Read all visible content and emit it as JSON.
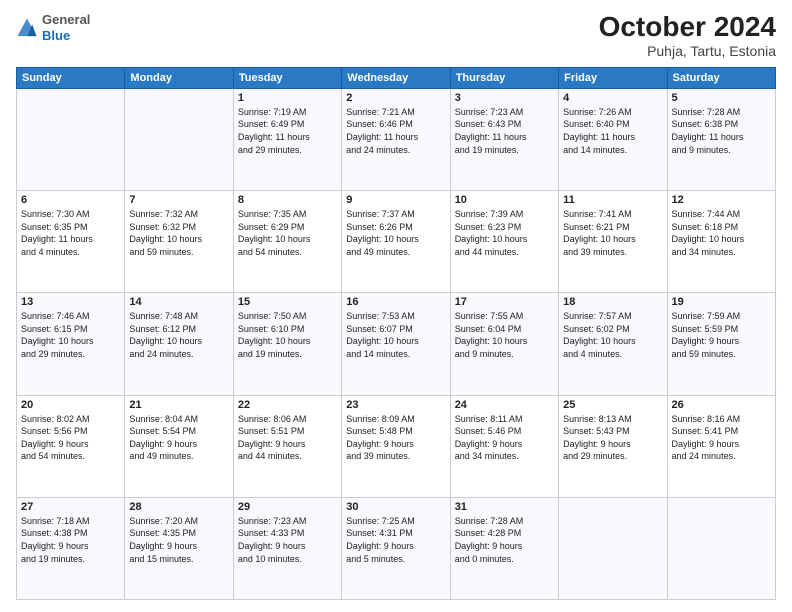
{
  "header": {
    "logo_line1": "General",
    "logo_line2": "Blue",
    "title": "October 2024",
    "subtitle": "Puhja, Tartu, Estonia"
  },
  "weekdays": [
    "Sunday",
    "Monday",
    "Tuesday",
    "Wednesday",
    "Thursday",
    "Friday",
    "Saturday"
  ],
  "weeks": [
    [
      {
        "day": "",
        "text": ""
      },
      {
        "day": "",
        "text": ""
      },
      {
        "day": "1",
        "text": "Sunrise: 7:19 AM\nSunset: 6:49 PM\nDaylight: 11 hours\nand 29 minutes."
      },
      {
        "day": "2",
        "text": "Sunrise: 7:21 AM\nSunset: 6:46 PM\nDaylight: 11 hours\nand 24 minutes."
      },
      {
        "day": "3",
        "text": "Sunrise: 7:23 AM\nSunset: 6:43 PM\nDaylight: 11 hours\nand 19 minutes."
      },
      {
        "day": "4",
        "text": "Sunrise: 7:26 AM\nSunset: 6:40 PM\nDaylight: 11 hours\nand 14 minutes."
      },
      {
        "day": "5",
        "text": "Sunrise: 7:28 AM\nSunset: 6:38 PM\nDaylight: 11 hours\nand 9 minutes."
      }
    ],
    [
      {
        "day": "6",
        "text": "Sunrise: 7:30 AM\nSunset: 6:35 PM\nDaylight: 11 hours\nand 4 minutes."
      },
      {
        "day": "7",
        "text": "Sunrise: 7:32 AM\nSunset: 6:32 PM\nDaylight: 10 hours\nand 59 minutes."
      },
      {
        "day": "8",
        "text": "Sunrise: 7:35 AM\nSunset: 6:29 PM\nDaylight: 10 hours\nand 54 minutes."
      },
      {
        "day": "9",
        "text": "Sunrise: 7:37 AM\nSunset: 6:26 PM\nDaylight: 10 hours\nand 49 minutes."
      },
      {
        "day": "10",
        "text": "Sunrise: 7:39 AM\nSunset: 6:23 PM\nDaylight: 10 hours\nand 44 minutes."
      },
      {
        "day": "11",
        "text": "Sunrise: 7:41 AM\nSunset: 6:21 PM\nDaylight: 10 hours\nand 39 minutes."
      },
      {
        "day": "12",
        "text": "Sunrise: 7:44 AM\nSunset: 6:18 PM\nDaylight: 10 hours\nand 34 minutes."
      }
    ],
    [
      {
        "day": "13",
        "text": "Sunrise: 7:46 AM\nSunset: 6:15 PM\nDaylight: 10 hours\nand 29 minutes."
      },
      {
        "day": "14",
        "text": "Sunrise: 7:48 AM\nSunset: 6:12 PM\nDaylight: 10 hours\nand 24 minutes."
      },
      {
        "day": "15",
        "text": "Sunrise: 7:50 AM\nSunset: 6:10 PM\nDaylight: 10 hours\nand 19 minutes."
      },
      {
        "day": "16",
        "text": "Sunrise: 7:53 AM\nSunset: 6:07 PM\nDaylight: 10 hours\nand 14 minutes."
      },
      {
        "day": "17",
        "text": "Sunrise: 7:55 AM\nSunset: 6:04 PM\nDaylight: 10 hours\nand 9 minutes."
      },
      {
        "day": "18",
        "text": "Sunrise: 7:57 AM\nSunset: 6:02 PM\nDaylight: 10 hours\nand 4 minutes."
      },
      {
        "day": "19",
        "text": "Sunrise: 7:59 AM\nSunset: 5:59 PM\nDaylight: 9 hours\nand 59 minutes."
      }
    ],
    [
      {
        "day": "20",
        "text": "Sunrise: 8:02 AM\nSunset: 5:56 PM\nDaylight: 9 hours\nand 54 minutes."
      },
      {
        "day": "21",
        "text": "Sunrise: 8:04 AM\nSunset: 5:54 PM\nDaylight: 9 hours\nand 49 minutes."
      },
      {
        "day": "22",
        "text": "Sunrise: 8:06 AM\nSunset: 5:51 PM\nDaylight: 9 hours\nand 44 minutes."
      },
      {
        "day": "23",
        "text": "Sunrise: 8:09 AM\nSunset: 5:48 PM\nDaylight: 9 hours\nand 39 minutes."
      },
      {
        "day": "24",
        "text": "Sunrise: 8:11 AM\nSunset: 5:46 PM\nDaylight: 9 hours\nand 34 minutes."
      },
      {
        "day": "25",
        "text": "Sunrise: 8:13 AM\nSunset: 5:43 PM\nDaylight: 9 hours\nand 29 minutes."
      },
      {
        "day": "26",
        "text": "Sunrise: 8:16 AM\nSunset: 5:41 PM\nDaylight: 9 hours\nand 24 minutes."
      }
    ],
    [
      {
        "day": "27",
        "text": "Sunrise: 7:18 AM\nSunset: 4:38 PM\nDaylight: 9 hours\nand 19 minutes."
      },
      {
        "day": "28",
        "text": "Sunrise: 7:20 AM\nSunset: 4:35 PM\nDaylight: 9 hours\nand 15 minutes."
      },
      {
        "day": "29",
        "text": "Sunrise: 7:23 AM\nSunset: 4:33 PM\nDaylight: 9 hours\nand 10 minutes."
      },
      {
        "day": "30",
        "text": "Sunrise: 7:25 AM\nSunset: 4:31 PM\nDaylight: 9 hours\nand 5 minutes."
      },
      {
        "day": "31",
        "text": "Sunrise: 7:28 AM\nSunset: 4:28 PM\nDaylight: 9 hours\nand 0 minutes."
      },
      {
        "day": "",
        "text": ""
      },
      {
        "day": "",
        "text": ""
      }
    ]
  ]
}
